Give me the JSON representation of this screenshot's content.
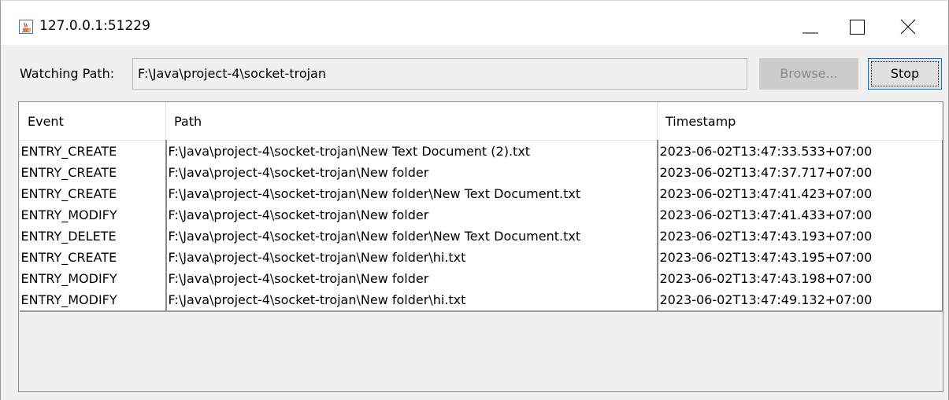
{
  "window": {
    "title": "127.0.0.1:51229",
    "app_icon": "java-coffee-cup-icon",
    "minimize_icon": "minimize-icon",
    "maximize_icon": "maximize-icon",
    "close_icon": "close-icon"
  },
  "toolbar": {
    "watching_label": "Watching Path:",
    "path_value": "F:\\Java\\project-4\\socket-trojan",
    "browse_label": "Browse...",
    "stop_label": "Stop"
  },
  "table": {
    "columns": [
      "Event",
      "Path",
      "Timestamp"
    ],
    "rows": [
      [
        "ENTRY_CREATE",
        "F:\\Java\\project-4\\socket-trojan\\New Text Document (2).txt",
        "2023-06-02T13:47:33.533+07:00"
      ],
      [
        "ENTRY_CREATE",
        "F:\\Java\\project-4\\socket-trojan\\New folder",
        "2023-06-02T13:47:37.717+07:00"
      ],
      [
        "ENTRY_CREATE",
        "F:\\Java\\project-4\\socket-trojan\\New folder\\New Text Document.txt",
        "2023-06-02T13:47:41.423+07:00"
      ],
      [
        "ENTRY_MODIFY",
        "F:\\Java\\project-4\\socket-trojan\\New folder",
        "2023-06-02T13:47:41.433+07:00"
      ],
      [
        "ENTRY_DELETE",
        "F:\\Java\\project-4\\socket-trojan\\New folder\\New Text Document.txt",
        "2023-06-02T13:47:43.193+07:00"
      ],
      [
        "ENTRY_CREATE",
        "F:\\Java\\project-4\\socket-trojan\\New folder\\hi.txt",
        "2023-06-02T13:47:43.195+07:00"
      ],
      [
        "ENTRY_MODIFY",
        "F:\\Java\\project-4\\socket-trojan\\New folder",
        "2023-06-02T13:47:43.198+07:00"
      ],
      [
        "ENTRY_MODIFY",
        "F:\\Java\\project-4\\socket-trojan\\New folder\\hi.txt",
        "2023-06-02T13:47:49.132+07:00"
      ]
    ]
  },
  "colors": {
    "accent": "#0078d7",
    "window_bg": "#f0f0f0",
    "disabled_button": "#cccccc"
  }
}
